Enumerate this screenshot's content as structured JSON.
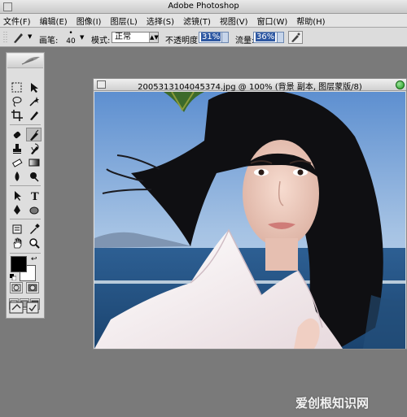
{
  "window": {
    "title": "Adobe Photoshop"
  },
  "menu": [
    "文件(F)",
    "编辑(E)",
    "图像(I)",
    "图层(L)",
    "选择(S)",
    "滤镜(T)",
    "视图(V)",
    "窗口(W)",
    "帮助(H)"
  ],
  "options": {
    "brush_label": "画笔:",
    "brush_size": "40",
    "mode_label": "模式:",
    "mode_value": "正常",
    "opacity_label": "不透明度:",
    "opacity_value": "31%",
    "flow_label": "流量:",
    "flow_value": "36%"
  },
  "document": {
    "title": "2005313104045374.jpg @ 100% (背景 副本, 图层蒙版/8)"
  },
  "watermark": "爱创根知识网",
  "colors": {
    "foreground": "#000000",
    "background": "#ffffff",
    "workspace": "#7a7a7a"
  }
}
